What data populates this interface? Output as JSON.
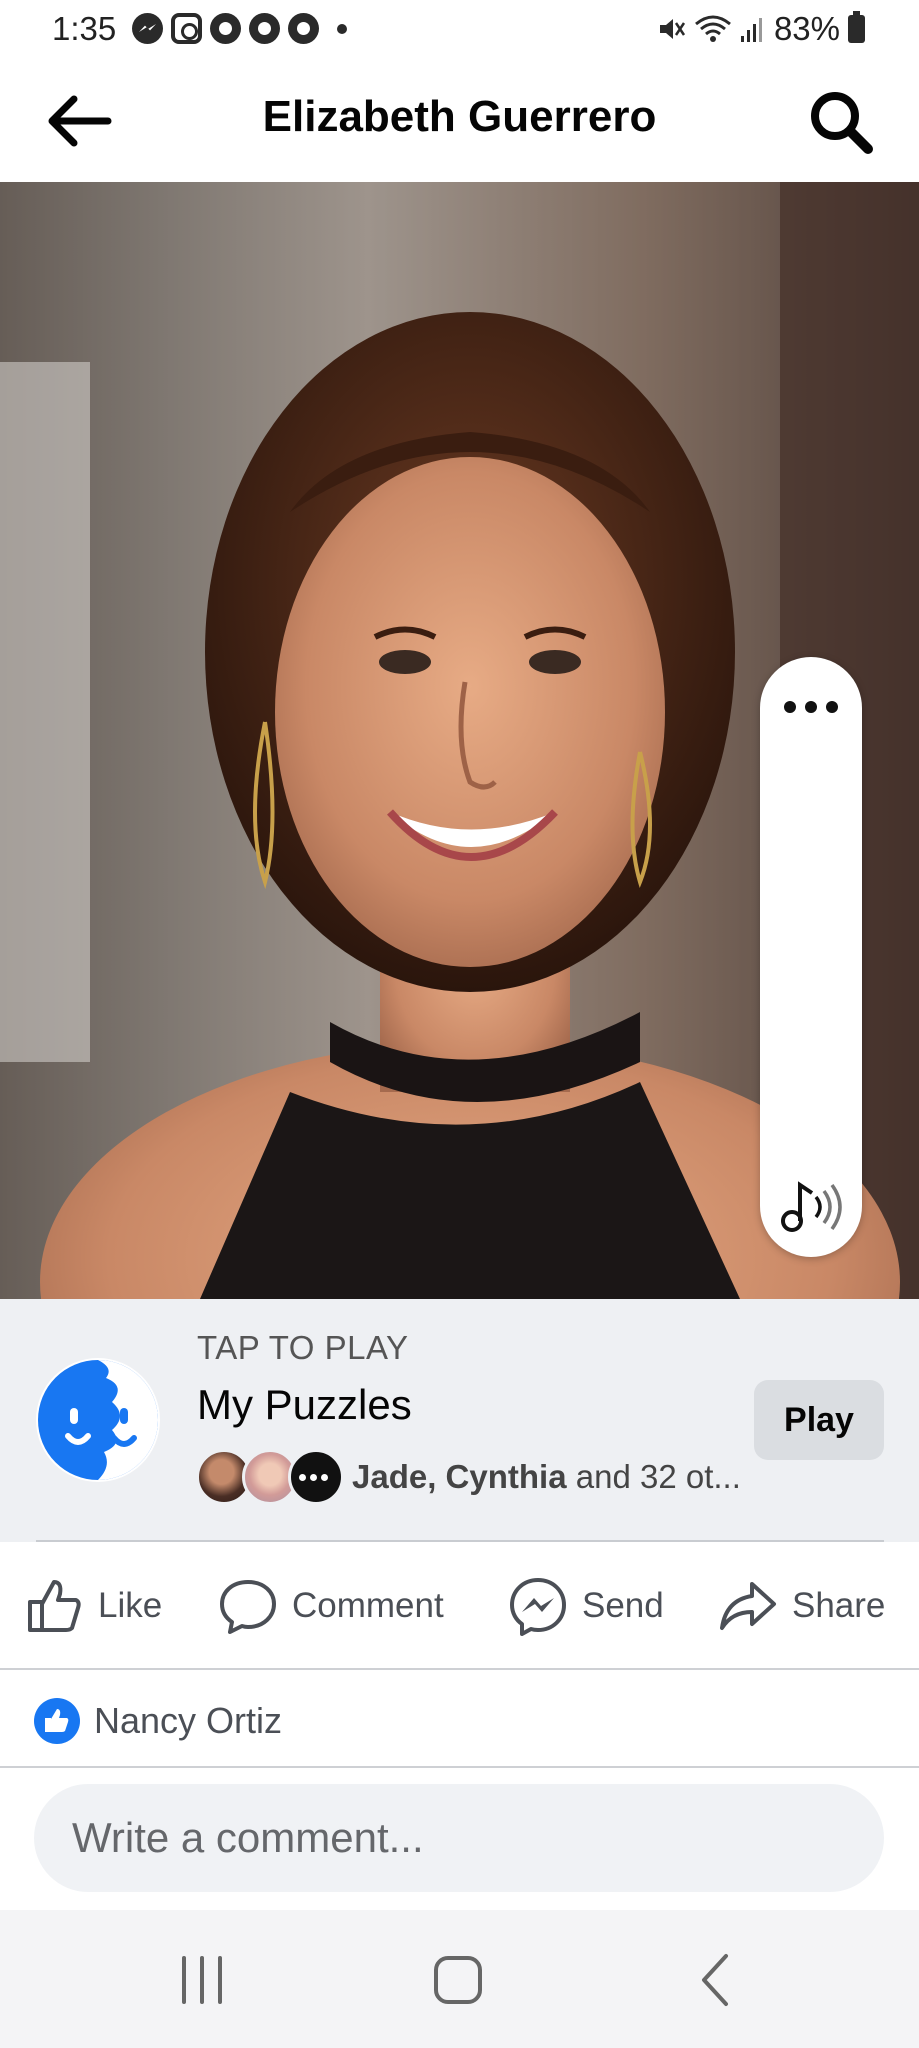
{
  "status_bar": {
    "time": "1:35",
    "battery": "83%",
    "left_icons": [
      "messenger-icon",
      "instagram-icon",
      "chrome-icon",
      "chrome-icon",
      "chrome-icon",
      "dot-icon"
    ],
    "right_icons": [
      "mute-icon",
      "wifi-icon",
      "signal-icon",
      "battery-icon"
    ]
  },
  "header": {
    "title": "Elizabeth Guerrero",
    "back_icon": "arrow-left-icon",
    "search_icon": "search-icon"
  },
  "media": {
    "controls": [
      "more-icon",
      "sound-icon"
    ]
  },
  "game": {
    "eyebrow": "TAP TO PLAY",
    "name": "My Puzzles",
    "friends_prefix": "Jade, Cynthia",
    "friends_suffix": " and 32 ot...",
    "play_label": "Play"
  },
  "actions": {
    "like": "Like",
    "comment": "Comment",
    "send": "Send",
    "share": "Share"
  },
  "reactions": {
    "name": "Nancy Ortiz"
  },
  "composer": {
    "placeholder": "Write a comment..."
  },
  "colors": {
    "accent": "#1877f2",
    "card_bg": "#eef0f3",
    "button_bg": "#dadde1"
  }
}
